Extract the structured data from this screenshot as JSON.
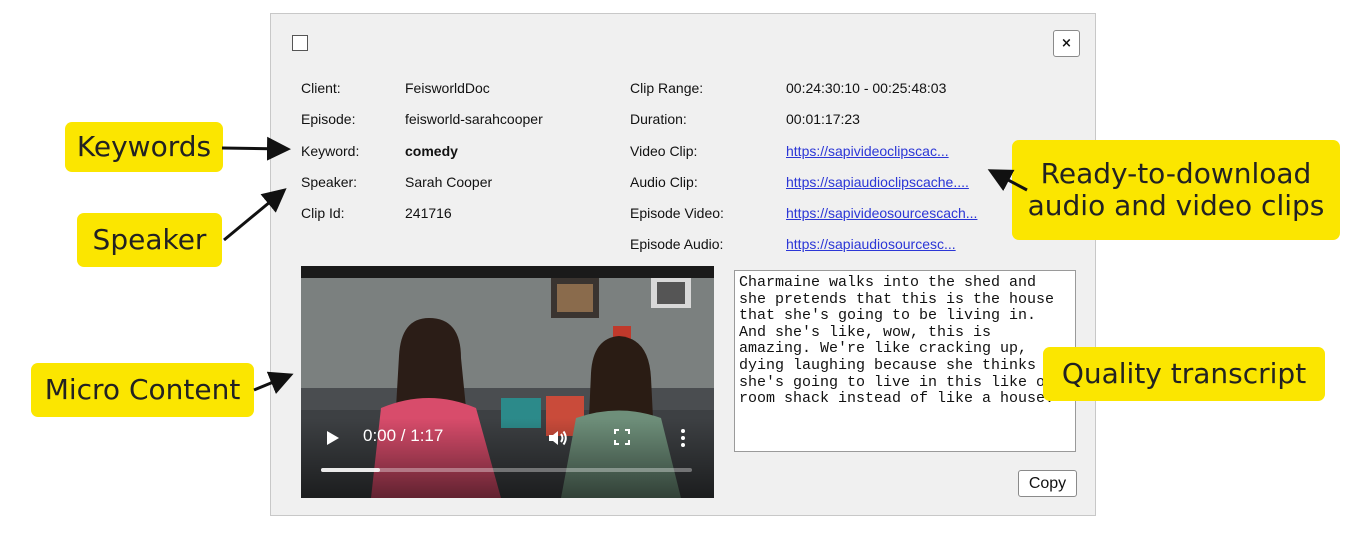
{
  "dialog": {
    "close_label": "×",
    "fields_left": [
      {
        "label": "Client:",
        "value": "FeisworldDoc"
      },
      {
        "label": "Episode:",
        "value": "feisworld-sarahcooper"
      },
      {
        "label": "Keyword:",
        "value": "comedy"
      },
      {
        "label": "Speaker:",
        "value": "Sarah Cooper"
      },
      {
        "label": "Clip Id:",
        "value": "241716"
      }
    ],
    "fields_right": [
      {
        "label": "Clip Range:",
        "value": "00:24:30:10 - 00:25:48:03"
      },
      {
        "label": "Duration:",
        "value": "00:01:17:23"
      },
      {
        "label": "Video Clip:",
        "value": "https://sapivideoclipscac..."
      },
      {
        "label": "Audio Clip:",
        "value": "https://sapiaudioclipscache...."
      },
      {
        "label": "Episode Video:",
        "value": "https://sapivideosourcescach..."
      },
      {
        "label": "Episode Audio:",
        "value": "https://sapiaudiosourcesc..."
      }
    ],
    "video": {
      "time": "0:00 / 1:17",
      "progress": 0.16
    },
    "transcript": "Charmaine walks into the shed and she pretends that this is the house that she's going to be living in. And she's like, wow, this is amazing. We're like cracking up, dying laughing because she thinks she's going to live in this like one room shack instead of like a house.",
    "copy_label": "Copy"
  },
  "callouts": {
    "keywords": "Keywords",
    "speaker": "Speaker",
    "micro_content": "Micro Content",
    "ready_line1": "Ready-to-download",
    "ready_line2": "audio and video clips",
    "quality": "Quality transcript"
  },
  "colors": {
    "callout": "#fbe600",
    "link": "#2b36d6",
    "dialog_bg": "#f0f0f0"
  }
}
